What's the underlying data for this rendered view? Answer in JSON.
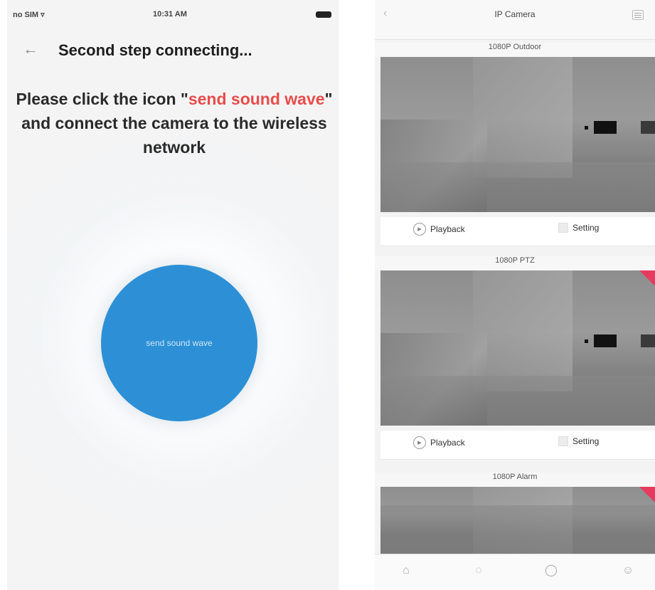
{
  "left_screen": {
    "status": {
      "carrier": "no SIM",
      "wifi_icon": "wifi-icon",
      "time": "10:31 AM",
      "battery_icon": "battery-icon"
    },
    "header": {
      "back_icon": "arrow-left-icon",
      "title": "Second step connecting..."
    },
    "instruction": {
      "part1": "Please click the icon \"",
      "highlight": "send sound wave",
      "part2": "\" and connect the camera to the wireless network"
    },
    "button": {
      "label": "send sound wave"
    },
    "colors": {
      "button_blue": "#2d90d6",
      "highlight_red": "#e84c4c"
    }
  },
  "right_screen": {
    "header": {
      "back_icon": "back-icon",
      "title": "IP Camera",
      "menu_icon": "menu-icon"
    },
    "cameras": [
      {
        "name": "1080P Outdoor",
        "playback": "Playback",
        "setting": "Setting",
        "badge": false
      },
      {
        "name": "1080P PTZ",
        "playback": "Playback",
        "setting": "Setting",
        "badge": true
      },
      {
        "name": "1080P Alarm",
        "badge": true
      }
    ],
    "tabs": [
      "home-icon",
      "bulb-icon",
      "message-icon",
      "profile-icon"
    ],
    "colors": {
      "badge": "#e63b5f"
    }
  }
}
